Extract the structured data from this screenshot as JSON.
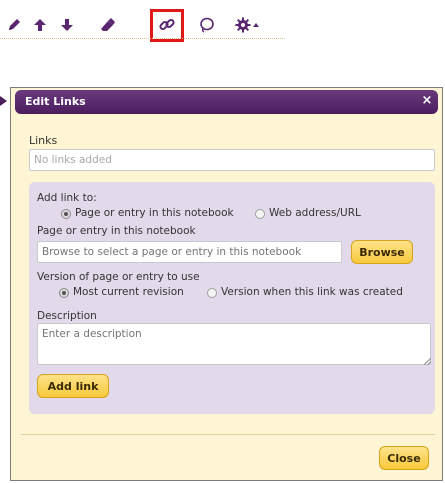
{
  "toolbar": {
    "icons": [
      "pencil-icon",
      "arrow-up-icon",
      "arrow-down-icon",
      "eraser-icon",
      "link-icon",
      "lasso-icon",
      "gear-icon",
      "caret-up-icon"
    ],
    "highlight_color": "#e01818",
    "icon_color": "#5a2670"
  },
  "dialog": {
    "title": "Edit Links",
    "close_glyph": "×",
    "links_label": "Links",
    "links_value": "No links added",
    "add_link_to_label": "Add link to:",
    "option_notebook": "Page or entry in this notebook",
    "option_web": "Web address/URL",
    "notebook_section_label": "Page or entry in this notebook",
    "browse_placeholder": "Browse to select a page or entry in this notebook",
    "browse_button": "Browse",
    "version_label": "Version of page or entry to use",
    "option_current": "Most current revision",
    "option_created": "Version when this link was created",
    "description_label": "Description",
    "description_placeholder": "Enter a description",
    "add_link_button": "Add link",
    "close_button": "Close"
  },
  "colors": {
    "titlebar": "#4b1d5d",
    "dialog_bg": "#fdf5d4",
    "panel_bg": "#e2d9ea",
    "button_yellow": "#f7c93c"
  }
}
